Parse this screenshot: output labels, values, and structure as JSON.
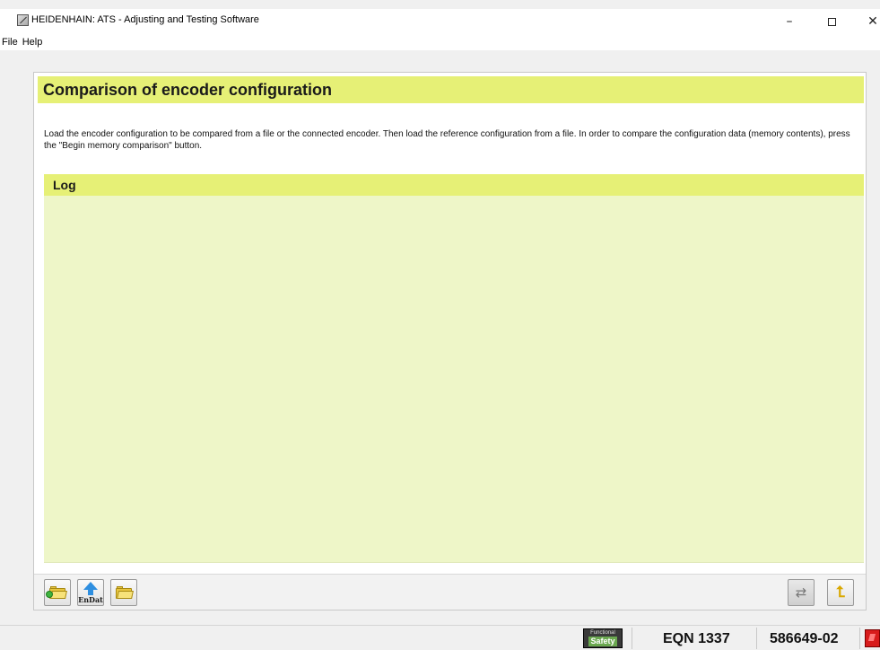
{
  "window": {
    "title": "HEIDENHAIN: ATS - Adjusting and Testing Software",
    "controls": {
      "minimize": "–",
      "close": "✕"
    }
  },
  "menu": {
    "items": [
      {
        "label": "File"
      },
      {
        "label": "Help"
      }
    ]
  },
  "page": {
    "title": "Comparison of encoder configuration",
    "description": "Load the encoder configuration to be compared from a file or the connected encoder. Then load the reference configuration from a file. In order to compare the configuration data (memory contents), press the \"Begin memory comparison\" button.",
    "log_title": "Log",
    "log_entries": []
  },
  "toolbar": {
    "left_buttons": [
      {
        "icon": "load-folder-icon"
      },
      {
        "icon": "endat-upload-icon",
        "label": "EnDat"
      },
      {
        "icon": "open-folder-icon"
      }
    ],
    "right_buttons": [
      {
        "icon": "memory-compare-icon"
      },
      {
        "icon": "back-icon"
      }
    ]
  },
  "statusbar": {
    "badge_line1": "Functional",
    "badge_line2": "Safety",
    "device": "EQN 1337",
    "serial": "586649-02",
    "indicator_color": "#d81b1b"
  },
  "colors": {
    "header_bar": "#e6f076",
    "log_background": "#eef6c8"
  }
}
